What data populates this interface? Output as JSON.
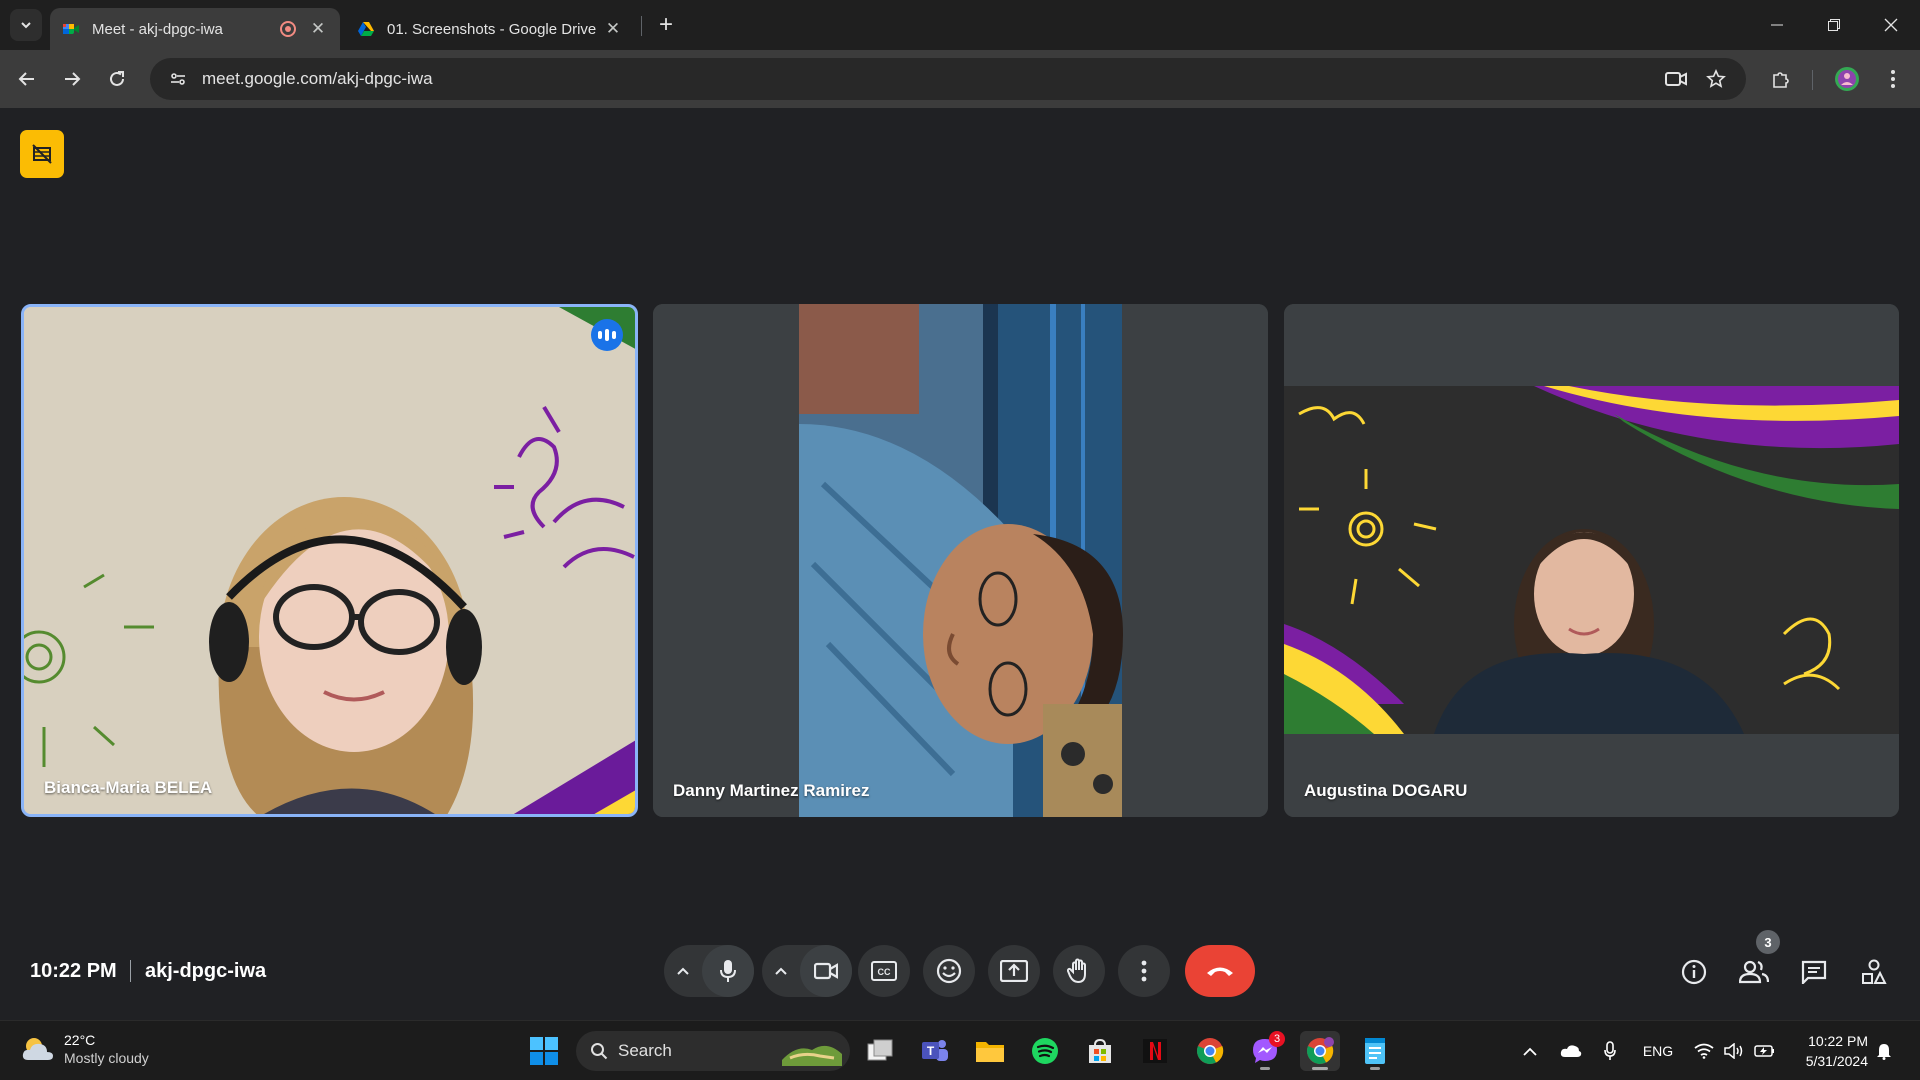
{
  "browser": {
    "tabs": [
      {
        "title": "Meet - akj-dpgc-iwa",
        "favicon": "google-meet-icon",
        "recording": true,
        "active": true
      },
      {
        "title": "01. Screenshots - Google Drive",
        "favicon": "google-drive-icon",
        "active": false
      }
    ],
    "new_tab_label": "+",
    "url": "meet.google.com/akj-dpgc-iwa"
  },
  "meet": {
    "participants": [
      {
        "name": "Bianca-Maria BELEA",
        "speaking": true
      },
      {
        "name": "Danny Martinez Ramirez",
        "speaking": false
      },
      {
        "name": "Augustina DOGARU",
        "speaking": false
      }
    ],
    "time": "10:22 PM",
    "meeting_code": "akj-dpgc-iwa",
    "people_count": "3",
    "colors": {
      "accent": "#8ab4f8",
      "end_call": "#ea4335",
      "badge": "#fbbc04"
    }
  },
  "taskbar": {
    "weather": {
      "temp": "22°C",
      "condition": "Mostly cloudy"
    },
    "search_label": "Search",
    "messenger_badge": "3",
    "language": "ENG",
    "clock_time": "10:22 PM",
    "clock_date": "5/31/2024"
  }
}
